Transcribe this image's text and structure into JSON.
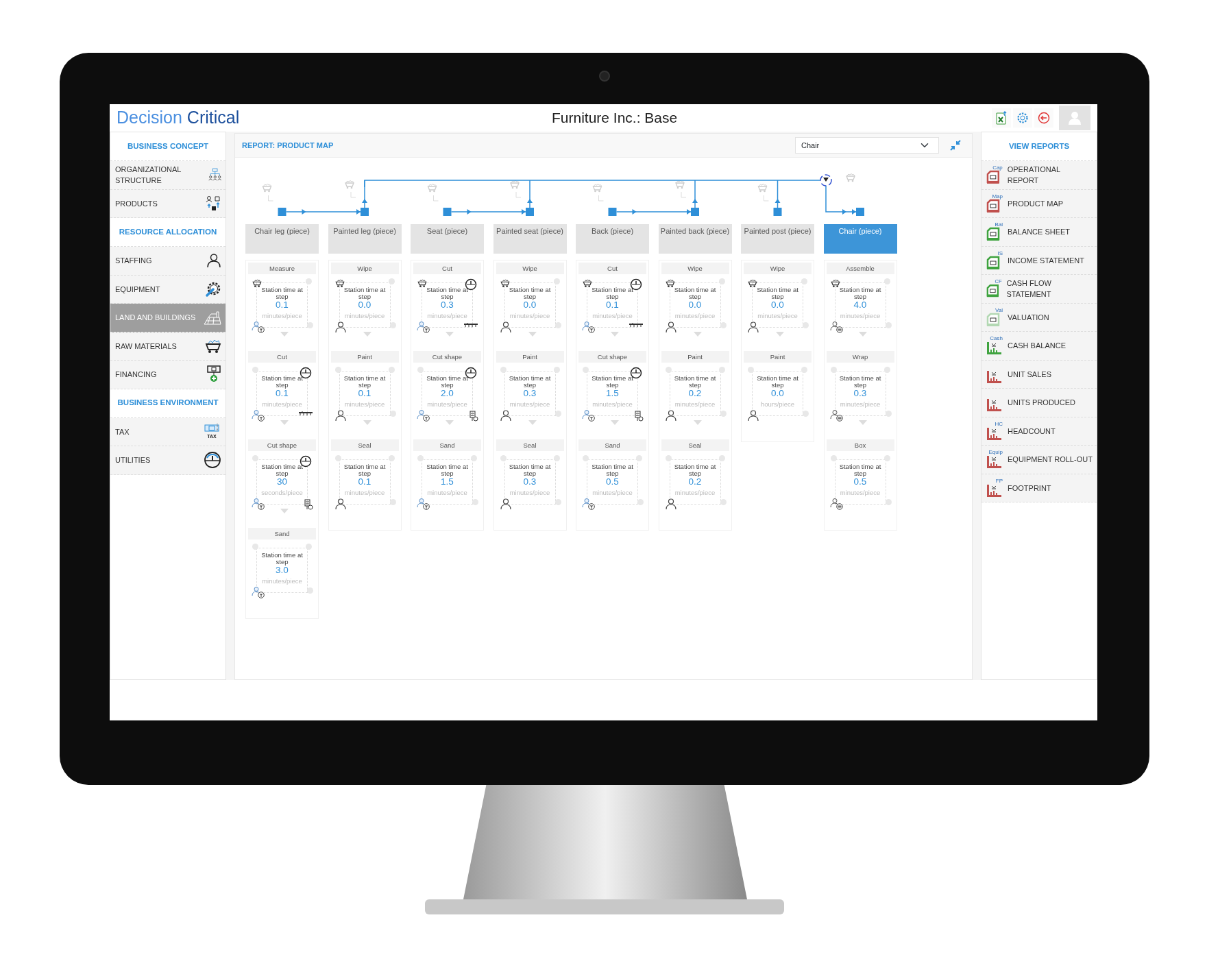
{
  "header": {
    "logo": [
      "Decision",
      "Critical"
    ],
    "title": "Furniture Inc.: Base"
  },
  "left_sidebar": {
    "items": [
      {
        "kind": "section",
        "label": "BUSINESS CONCEPT"
      },
      {
        "kind": "item",
        "label": "ORGANIZATIONAL STRUCTURE",
        "selected": false
      },
      {
        "kind": "item",
        "label": "PRODUCTS",
        "selected": false
      },
      {
        "kind": "section",
        "label": "RESOURCE ALLOCATION"
      },
      {
        "kind": "item",
        "label": "STAFFING",
        "selected": false
      },
      {
        "kind": "item",
        "label": "EQUIPMENT",
        "selected": false
      },
      {
        "kind": "item",
        "label": "LAND AND BUILDINGS",
        "selected": true
      },
      {
        "kind": "item",
        "label": "RAW MATERIALS",
        "selected": false
      },
      {
        "kind": "item",
        "label": "FINANCING",
        "selected": false
      },
      {
        "kind": "section",
        "label": "BUSINESS ENVIRONMENT"
      },
      {
        "kind": "item",
        "label": "TAX",
        "selected": false,
        "icon_label": "TAX"
      },
      {
        "kind": "item",
        "label": "UTILITIES",
        "selected": false
      }
    ]
  },
  "report": {
    "title": "REPORT: PRODUCT MAP",
    "product_select": {
      "value": "Chair"
    },
    "columns": [
      {
        "product": "Chair leg (piece)",
        "selected": false,
        "steps": [
          {
            "name": "Measure",
            "label": "Station time at step",
            "value": "0.1",
            "unit": "minutes/piece",
            "material": true,
            "utility": false,
            "labor": {
              "kind": "skilled"
            }
          },
          {
            "name": "Cut",
            "label": "Station time at step",
            "value": "0.1",
            "unit": "minutes/piece",
            "material": false,
            "utility": true,
            "labor": {
              "kind": "skilled"
            },
            "equipment": {
              "kind": "saw"
            }
          },
          {
            "name": "Cut shape",
            "label": "Station time at step",
            "value": "30",
            "unit": "seconds/piece",
            "material": false,
            "utility": true,
            "labor": {
              "kind": "skilled"
            },
            "equipment": {
              "kind": "machine"
            }
          },
          {
            "name": "Sand",
            "label": "Station time at step",
            "value": "3.0",
            "unit": "minutes/piece",
            "material": false,
            "utility": false,
            "labor": {
              "kind": "skilled"
            }
          }
        ]
      },
      {
        "product": "Painted leg (piece)",
        "selected": false,
        "steps": [
          {
            "name": "Wipe",
            "label": "Station time at step",
            "value": "0.0",
            "unit": "minutes/piece",
            "material": true,
            "utility": false,
            "labor": {
              "kind": "manual"
            }
          },
          {
            "name": "Paint",
            "label": "Station time at step",
            "value": "0.1",
            "unit": "minutes/piece",
            "material": false,
            "utility": false,
            "labor": {
              "kind": "manual"
            }
          },
          {
            "name": "Seal",
            "label": "Station time at step",
            "value": "0.1",
            "unit": "minutes/piece",
            "material": false,
            "utility": false,
            "labor": {
              "kind": "manual"
            }
          }
        ]
      },
      {
        "product": "Seat (piece)",
        "selected": false,
        "steps": [
          {
            "name": "Cut",
            "label": "Station time at step",
            "value": "0.3",
            "unit": "minutes/piece",
            "material": true,
            "utility": true,
            "labor": {
              "kind": "skilled"
            },
            "equipment": {
              "kind": "saw"
            }
          },
          {
            "name": "Cut shape",
            "label": "Station time at step",
            "value": "2.0",
            "unit": "minutes/piece",
            "material": false,
            "utility": true,
            "labor": {
              "kind": "skilled"
            },
            "equipment": {
              "kind": "machine"
            }
          },
          {
            "name": "Sand",
            "label": "Station time at step",
            "value": "1.5",
            "unit": "minutes/piece",
            "material": false,
            "utility": false,
            "labor": {
              "kind": "skilled"
            }
          }
        ]
      },
      {
        "product": "Painted seat (piece)",
        "selected": false,
        "steps": [
          {
            "name": "Wipe",
            "label": "Station time at step",
            "value": "0.0",
            "unit": "minutes/piece",
            "material": true,
            "utility": false,
            "labor": {
              "kind": "manual"
            }
          },
          {
            "name": "Paint",
            "label": "Station time at step",
            "value": "0.3",
            "unit": "minutes/piece",
            "material": false,
            "utility": false,
            "labor": {
              "kind": "manual"
            }
          },
          {
            "name": "Seal",
            "label": "Station time at step",
            "value": "0.3",
            "unit": "minutes/piece",
            "material": false,
            "utility": false,
            "labor": {
              "kind": "manual"
            }
          }
        ]
      },
      {
        "product": "Back (piece)",
        "selected": false,
        "steps": [
          {
            "name": "Cut",
            "label": "Station time at step",
            "value": "0.1",
            "unit": "minutes/piece",
            "material": true,
            "utility": true,
            "labor": {
              "kind": "skilled"
            },
            "equipment": {
              "kind": "saw"
            }
          },
          {
            "name": "Cut shape",
            "label": "Station time at step",
            "value": "1.5",
            "unit": "minutes/piece",
            "material": false,
            "utility": true,
            "labor": {
              "kind": "skilled"
            },
            "equipment": {
              "kind": "machine"
            }
          },
          {
            "name": "Sand",
            "label": "Station time at step",
            "value": "0.5",
            "unit": "minutes/piece",
            "material": false,
            "utility": false,
            "labor": {
              "kind": "skilled"
            }
          }
        ]
      },
      {
        "product": "Painted back (piece)",
        "selected": false,
        "steps": [
          {
            "name": "Wipe",
            "label": "Station time at step",
            "value": "0.0",
            "unit": "minutes/piece",
            "material": true,
            "utility": false,
            "labor": {
              "kind": "manual"
            }
          },
          {
            "name": "Paint",
            "label": "Station time at step",
            "value": "0.2",
            "unit": "minutes/piece",
            "material": false,
            "utility": false,
            "labor": {
              "kind": "manual"
            }
          },
          {
            "name": "Seal",
            "label": "Station time at step",
            "value": "0.2",
            "unit": "minutes/piece",
            "material": false,
            "utility": false,
            "labor": {
              "kind": "manual"
            }
          }
        ]
      },
      {
        "product": "Painted post (piece)",
        "selected": false,
        "steps": [
          {
            "name": "Wipe",
            "label": "Station time at step",
            "value": "0.0",
            "unit": "minutes/piece",
            "material": true,
            "utility": false,
            "labor": {
              "kind": "manual"
            }
          },
          {
            "name": "Paint",
            "label": "Station time at step",
            "value": "0.0",
            "unit": "hours/piece",
            "material": false,
            "utility": false,
            "labor": {
              "kind": "manual"
            }
          }
        ]
      },
      {
        "product": "Chair (piece)",
        "selected": true,
        "steps": [
          {
            "name": "Assemble",
            "label": "Station time at step",
            "value": "4.0",
            "unit": "minutes/piece",
            "material": true,
            "utility": false,
            "labor": {
              "kind": "assisted"
            }
          },
          {
            "name": "Wrap",
            "label": "Station time at step",
            "value": "0.3",
            "unit": "minutes/piece",
            "material": false,
            "utility": false,
            "labor": {
              "kind": "assisted"
            }
          },
          {
            "name": "Box",
            "label": "Station time at step",
            "value": "0.5",
            "unit": "minutes/piece",
            "material": false,
            "utility": false,
            "labor": {
              "kind": "assisted"
            }
          }
        ]
      }
    ]
  },
  "right_sidebar": {
    "title": "VIEW REPORTS",
    "items": [
      {
        "label": "OPERATIONAL REPORT",
        "icon_label": "Cap",
        "kind": "document",
        "color": "#c0504d"
      },
      {
        "label": "PRODUCT MAP",
        "icon_label": "Map",
        "kind": "document",
        "color": "#c0504d"
      },
      {
        "label": "BALANCE SHEET",
        "icon_label": "Bal",
        "kind": "document",
        "color": "#3fa33f"
      },
      {
        "label": "INCOME STATEMENT",
        "icon_label": "IS",
        "kind": "document",
        "color": "#3fa33f"
      },
      {
        "label": "CASH FLOW STATEMENT",
        "icon_label": "CF",
        "kind": "document",
        "color": "#3fa33f"
      },
      {
        "label": "VALUATION",
        "icon_label": "Val",
        "kind": "document",
        "color": "#b3d8b3"
      },
      {
        "label": "CASH BALANCE",
        "icon_label": "Cash",
        "kind": "chart",
        "color": "#3fa33f"
      },
      {
        "label": "UNIT SALES",
        "kind": "chart",
        "color": "#c0504d"
      },
      {
        "label": "UNITS PRODUCED",
        "kind": "chart",
        "color": "#c0504d"
      },
      {
        "label": "HEADCOUNT",
        "icon_label": "HC",
        "kind": "chart",
        "color": "#c0504d"
      },
      {
        "label": "EQUIPMENT ROLL-OUT",
        "icon_label": "Equip",
        "kind": "chart",
        "color": "#c0504d"
      },
      {
        "label": "FOOTPRINT",
        "icon_label": "FP",
        "kind": "chart",
        "color": "#c0504d"
      }
    ]
  }
}
